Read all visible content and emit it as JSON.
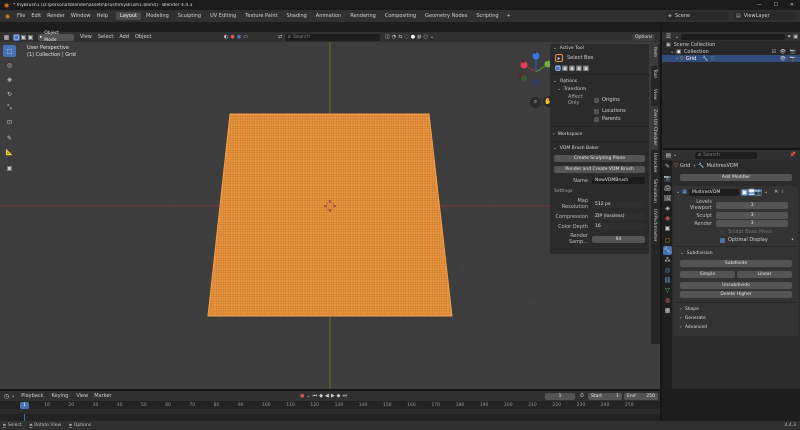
{
  "title": "* myBrush1 [D:\\personal\\blender\\assets\\brush\\myBrush1.blend] - Blender 4.4.3",
  "menu": [
    "File",
    "Edit",
    "Render",
    "Window",
    "Help"
  ],
  "workspaces": [
    "Layout",
    "Modeling",
    "Sculpting",
    "UV Editing",
    "Texture Paint",
    "Shading",
    "Animation",
    "Rendering",
    "Compositing",
    "Geometry Nodes",
    "Scripting"
  ],
  "scene": "Scene",
  "view_layer": "ViewLayer",
  "viewport_header": {
    "mode": "Object Mode",
    "menus": [
      "View",
      "Select",
      "Add",
      "Object"
    ],
    "orientation": "Global",
    "options": "Options",
    "search_placeholder": "Search"
  },
  "overlay": {
    "view_name": "User Perspective",
    "collection": "(1) Collection | Grid"
  },
  "gizmo": {
    "x": "X",
    "y": "Y",
    "z": "Z"
  },
  "npanel": {
    "active_tool": "Active Tool",
    "select_box": "Select Box",
    "options": "Options",
    "transform": "Transform",
    "affect_only": "Affect Only",
    "origins": "Origins",
    "locations": "Locations",
    "parents": "Parents",
    "workspace": "Workspace",
    "vdm_baker": "VDM Brush Baker",
    "create_planes": "Create Sculpting Plane",
    "render_create": "Render and Create VDM Brush",
    "name_label": "Name",
    "name_value": "NewVDMBrush",
    "settings": "Settings",
    "map_res_label": "Map Resolution",
    "map_res_value": "512 px",
    "compression_label": "Compression",
    "compression_value": "ZIP (lossless)",
    "color_depth_label": "Color Depth",
    "color_depth_value": "16",
    "render_samples_label": "Render Samp...",
    "render_samples_value": "64"
  },
  "npanel_tabs": [
    "Item",
    "Tool",
    "View",
    "Zen UV Checker",
    "Unlocker",
    "Simulation",
    "UVPackmaster"
  ],
  "outliner": {
    "search": "",
    "scene_collection": "Scene Collection",
    "collection": "Collection",
    "grid": "Grid"
  },
  "properties": {
    "search_placeholder": "Search",
    "object_name": "Grid",
    "modifier_breadcrumb": "MultiresVDM",
    "add_modifier": "Add Modifier",
    "modifier_name": "MultiresVDM",
    "levels_viewport_label": "Levels Viewport",
    "levels_viewport_value": "3",
    "sculpt_label": "Sculpt",
    "sculpt_value": "3",
    "render_label": "Render",
    "render_value": "3",
    "sculpt_base_mesh": "Sculpt Base Mesh",
    "optimal_display": "Optimal Display",
    "subdivision": "Subdivision",
    "subdivide": "Subdivide",
    "simple": "Simple",
    "linear": "Linear",
    "unsubdivide": "Unsubdivide",
    "delete_higher": "Delete Higher",
    "shape": "Shape",
    "generate": "Generate",
    "advanced": "Advanced"
  },
  "timeline": {
    "menus": [
      "Playback",
      "Keying",
      "View",
      "Marker"
    ],
    "current_frame": "1",
    "start_label": "Start",
    "start_value": "1",
    "end_label": "End",
    "end_value": "250",
    "ruler": [
      "1",
      "10",
      "20",
      "30",
      "40",
      "50",
      "60",
      "70",
      "80",
      "90",
      "100",
      "110",
      "120",
      "130",
      "140",
      "150",
      "160",
      "170",
      "180",
      "190",
      "200",
      "210",
      "220",
      "230",
      "240",
      "250"
    ]
  },
  "status": {
    "select": "Select",
    "rotate": "Rotate View",
    "options": "Options",
    "version": "4.4.3"
  },
  "colors": {
    "accent": "#4772b3",
    "selection": "#e89640",
    "xaxis": "#8d2f3b",
    "yaxis": "#6a8c2b"
  }
}
